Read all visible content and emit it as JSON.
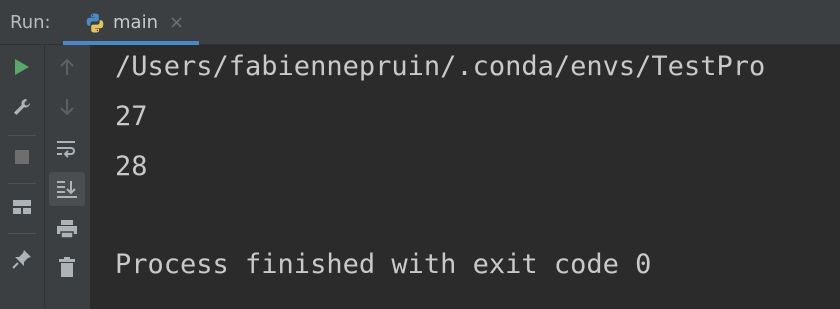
{
  "run_bar": {
    "label": "Run:",
    "tab": {
      "label": "main",
      "close": "×"
    }
  },
  "left_toolbar": {
    "icons": [
      "run-icon",
      "wrench-icon",
      "stop-icon",
      "layout-icon",
      "pin-icon"
    ]
  },
  "console_toolbar": {
    "icons": [
      "arrow-up-icon",
      "arrow-down-icon",
      "soft-wrap-icon",
      "scroll-to-end-icon",
      "print-icon",
      "trash-icon"
    ]
  },
  "console": {
    "lines": [
      "/Users/fabiennepruin/.conda/envs/TestPro",
      "27",
      "28",
      "",
      "Process finished with exit code 0"
    ]
  },
  "colors": {
    "accent": "#4a88c7",
    "run_green": "#59a869",
    "text": "#c9c9c9"
  }
}
